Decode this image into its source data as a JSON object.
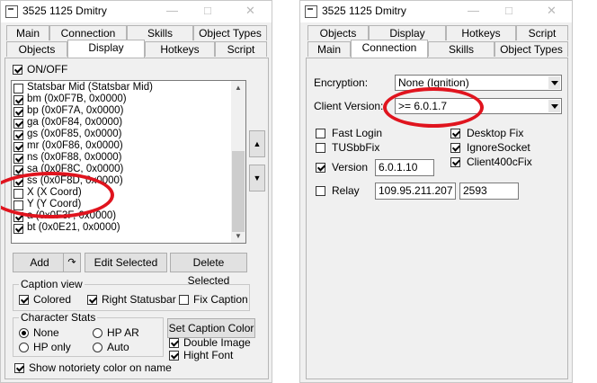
{
  "left_window": {
    "title": "3525 1125 Dmitry",
    "tabs_row1": [
      "Main",
      "Connection",
      "Skills",
      "Object Types"
    ],
    "tabs_row2": [
      "Objects",
      "Display",
      "Hotkeys",
      "Script"
    ],
    "selected_tab": "Display",
    "onoff_label": "ON/OFF",
    "list_items": [
      {
        "label": "Statsbar Mid (Statsbar Mid)",
        "checked": false
      },
      {
        "label": "bm (0x0F7B, 0x0000)",
        "checked": true
      },
      {
        "label": "bp (0x0F7A, 0x0000)",
        "checked": true
      },
      {
        "label": "ga (0x0F84, 0x0000)",
        "checked": true
      },
      {
        "label": "gs (0x0F85, 0x0000)",
        "checked": true
      },
      {
        "label": "mr (0x0F86, 0x0000)",
        "checked": true
      },
      {
        "label": "ns (0x0F88, 0x0000)",
        "checked": true
      },
      {
        "label": "sa (0x0F8C, 0x0000)",
        "checked": true
      },
      {
        "label": "ss (0x0F8D, 0x0000)",
        "checked": true
      },
      {
        "label": "X (X Coord)",
        "checked": false
      },
      {
        "label": "Y (Y Coord)",
        "checked": false
      },
      {
        "label": "a (0x0F3F, 0x0000)",
        "checked": true
      },
      {
        "label": "bt (0x0E21, 0x0000)",
        "checked": true
      }
    ],
    "buttons": {
      "add": "Add",
      "edit_selected": "Edit Selected",
      "delete_selected": "Delete Selected",
      "set_caption_color": "Set Caption Color"
    },
    "caption_view": {
      "title": "Caption view",
      "colored": "Colored",
      "right_statusbar": "Right Statusbar",
      "fix_caption": "Fix Caption"
    },
    "character_stats": {
      "title": "Character Stats",
      "none": "None",
      "hp_ar": "HP AR",
      "hp_only": "HP only",
      "auto": "Auto"
    },
    "double_image": "Double Image",
    "hight_font": "Hight Font",
    "show_notoriety": "Show notoriety color on name"
  },
  "right_window": {
    "title": "3525 1125 Dmitry",
    "tabs_row1": [
      "Objects",
      "Display",
      "Hotkeys",
      "Script"
    ],
    "tabs_row2": [
      "Main",
      "Connection",
      "Skills",
      "Object Types"
    ],
    "selected_tab": "Connection",
    "encryption_label": "Encryption:",
    "encryption_value": "None (Ignition)",
    "client_version_label": "Client Version:",
    "client_version_value": ">= 6.0.1.7",
    "fast_login": "Fast Login",
    "tusbbfix": "TUSbbFix",
    "version_label": "Version",
    "version_value": "6.0.1.10",
    "relay_label": "Relay",
    "relay_ip": "109.95.211.207",
    "relay_port": "2593",
    "desktop_fix": "Desktop Fix",
    "ignore_socket": "IgnoreSocket",
    "client400cfix": "Client400cFix"
  }
}
